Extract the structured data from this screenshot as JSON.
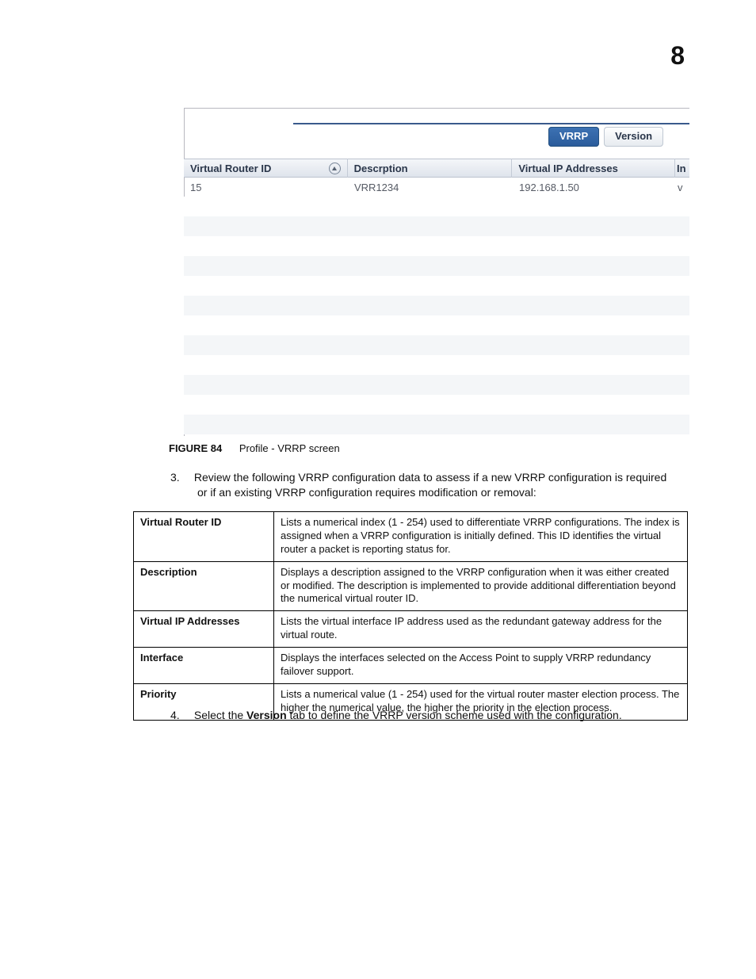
{
  "chapter_number": "8",
  "figure": {
    "tabs": {
      "active": "VRRP",
      "inactive": "Version"
    },
    "grid_headers": {
      "col1": "Virtual Router ID",
      "col2": "Descrption",
      "col3": "Virtual IP Addresses",
      "col4_fragment": "In"
    },
    "grid_row": {
      "router_id": "15",
      "description": "VRR1234",
      "vip": "192.168.1.50",
      "col4_fragment": "v"
    },
    "caption_label": "FIGURE 84",
    "caption_text": "Profile - VRRP screen"
  },
  "step3": {
    "num": "3.",
    "text_line1": "Review the following VRRP configuration data to assess if a new VRRP configuration is required",
    "text_line2": "or if an existing VRRP configuration requires modification or removal:"
  },
  "desc_rows": [
    {
      "term": "Virtual Router ID",
      "defn": "Lists a numerical index (1 - 254) used to differentiate VRRP configurations. The index is assigned when a VRRP configuration is initially defined. This ID identifies the virtual router a packet is reporting status for."
    },
    {
      "term": "Description",
      "defn": "Displays a description assigned to the VRRP configuration when it was either created or modified. The description is implemented to provide additional differentiation beyond the numerical virtual router ID."
    },
    {
      "term": "Virtual IP Addresses",
      "defn": "Lists the virtual interface IP address used as the redundant gateway address for the virtual route."
    },
    {
      "term": "Interface",
      "defn": "Displays the interfaces selected on the Access Point to supply VRRP redundancy failover support."
    },
    {
      "term": "Priority",
      "defn": "Lists a numerical value (1 - 254) used for the virtual router master election process. The higher the numerical value, the higher the priority in the election process."
    }
  ],
  "step4": {
    "num": "4.",
    "prefix": "Select the ",
    "bold": "Version",
    "suffix": " tab to define the VRRP version scheme used with the configuration."
  }
}
